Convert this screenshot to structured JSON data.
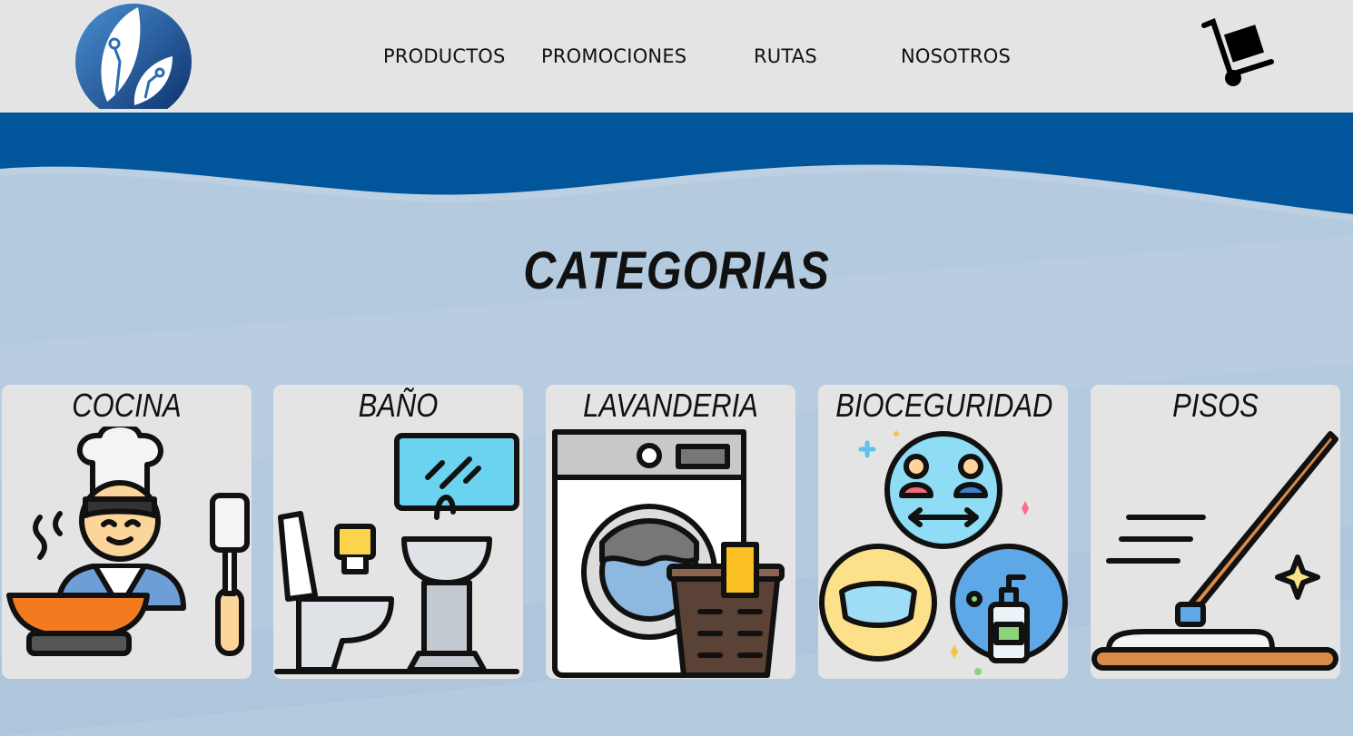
{
  "header": {
    "logo_name": "leaf-circuit-logo",
    "nav": [
      {
        "label": "PRODUCTOS"
      },
      {
        "label": "PROMOCIONES"
      },
      {
        "label": "RUTAS"
      },
      {
        "label": "NOSOTROS"
      }
    ],
    "cart_icon": "hand-truck-cart-icon"
  },
  "main": {
    "title": "CATEGORIAS",
    "categories": [
      {
        "label": "COCINA",
        "icon": "chef-cooking-icon"
      },
      {
        "label": "BAÑO",
        "icon": "bathroom-toilet-sink-icon"
      },
      {
        "label": "LAVANDERIA",
        "icon": "washing-machine-basket-icon"
      },
      {
        "label": "BIOCEGURIDAD",
        "icon": "biosecurity-distance-mask-sanitizer-icon"
      },
      {
        "label": "PISOS",
        "icon": "mop-floor-icon"
      }
    ]
  },
  "colors": {
    "header_bg": "#e4e4e4",
    "wave_blue": "#00559b",
    "page_bg": "#b4cadf",
    "card_bg": "#e4e4e4"
  }
}
